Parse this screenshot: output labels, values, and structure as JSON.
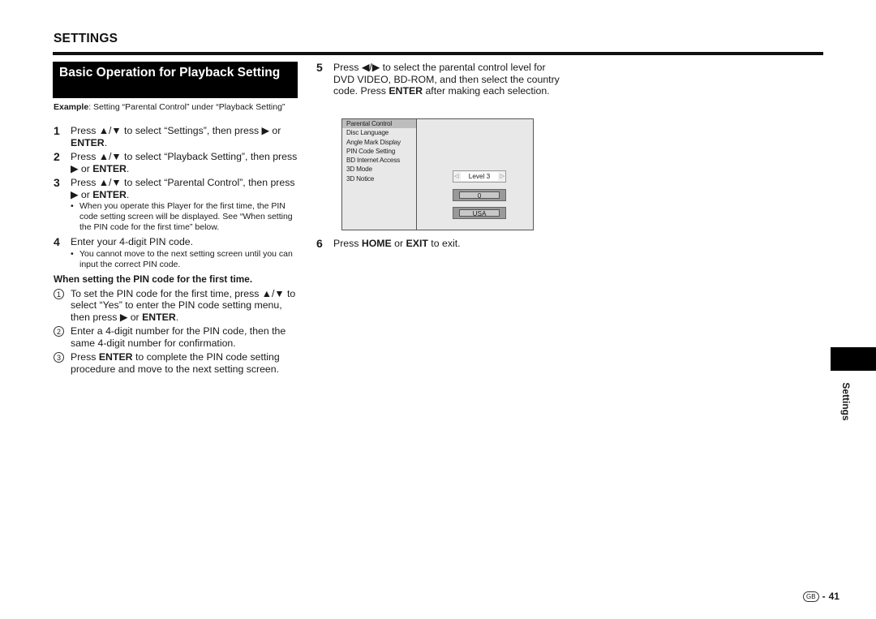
{
  "section_title": "SETTINGS",
  "heading": "Basic Operation for Playback Setting",
  "example": {
    "label": "Example",
    "text": ": Setting “Parental Control” under “Playback Setting”"
  },
  "left_steps": [
    {
      "num": "1",
      "pre": "Press ▲/▼ to select “Settings”, then press ▶ or ",
      "bold": "ENTER",
      "post": "."
    },
    {
      "num": "2",
      "pre": "Press ▲/▼ to select “Playback Setting”, then press ▶ or ",
      "bold": "ENTER",
      "post": "."
    },
    {
      "num": "3",
      "pre": "Press ▲/▼ to select “Parental Control”, then press ▶ or ",
      "bold": "ENTER",
      "post": ".",
      "bullet": "When you operate this Player for the first time, the PIN code setting screen will be displayed. See “When setting the PIN code for the first time” below."
    },
    {
      "num": "4",
      "pre": "Enter your 4-digit PIN code.",
      "bold": "",
      "post": "",
      "bullet": "You cannot move to the next setting screen until you can input the correct PIN code."
    }
  ],
  "pin_section": {
    "heading": "When setting the PIN code for the first time.",
    "steps": [
      {
        "num": "1",
        "pre": "To set the PIN code for the first time, press ▲/▼ to select “Yes” to enter the PIN code setting menu, then press ▶ or ",
        "bold": "ENTER",
        "post": "."
      },
      {
        "num": "2",
        "pre": "Enter a 4-digit number for the PIN code, then the same 4-digit number for confirmation.",
        "bold": "",
        "post": ""
      },
      {
        "num": "3",
        "pre": "Press ",
        "bold": "ENTER",
        "post": " to complete the PIN code setting procedure and move to the next setting screen."
      }
    ]
  },
  "right_steps": [
    {
      "num": "5",
      "pre": "Press ◀/▶ to select the parental control level for DVD VIDEO, BD-ROM, and then select the country code. Press ",
      "bold": "ENTER",
      "post": " after making each selection."
    },
    {
      "num": "6",
      "pre": "Press ",
      "bold": "HOME",
      "mid": " or ",
      "bold2": "EXIT",
      "post": " to exit."
    }
  ],
  "screen": {
    "menu_items": [
      "Parental Control",
      "Disc Language",
      "Angle Mark Display",
      "PIN Code Setting",
      "BD Internet Access",
      "3D Mode",
      "3D Notice"
    ],
    "selected_index": 0,
    "level_value": "Level 3",
    "left_arrow": "◁",
    "right_arrow": "▷",
    "pin_value": "0",
    "country_value": "USA"
  },
  "side_tab_label": "Settings",
  "footer": {
    "region_badge": "GB",
    "separator": "-",
    "page_number": "41"
  }
}
